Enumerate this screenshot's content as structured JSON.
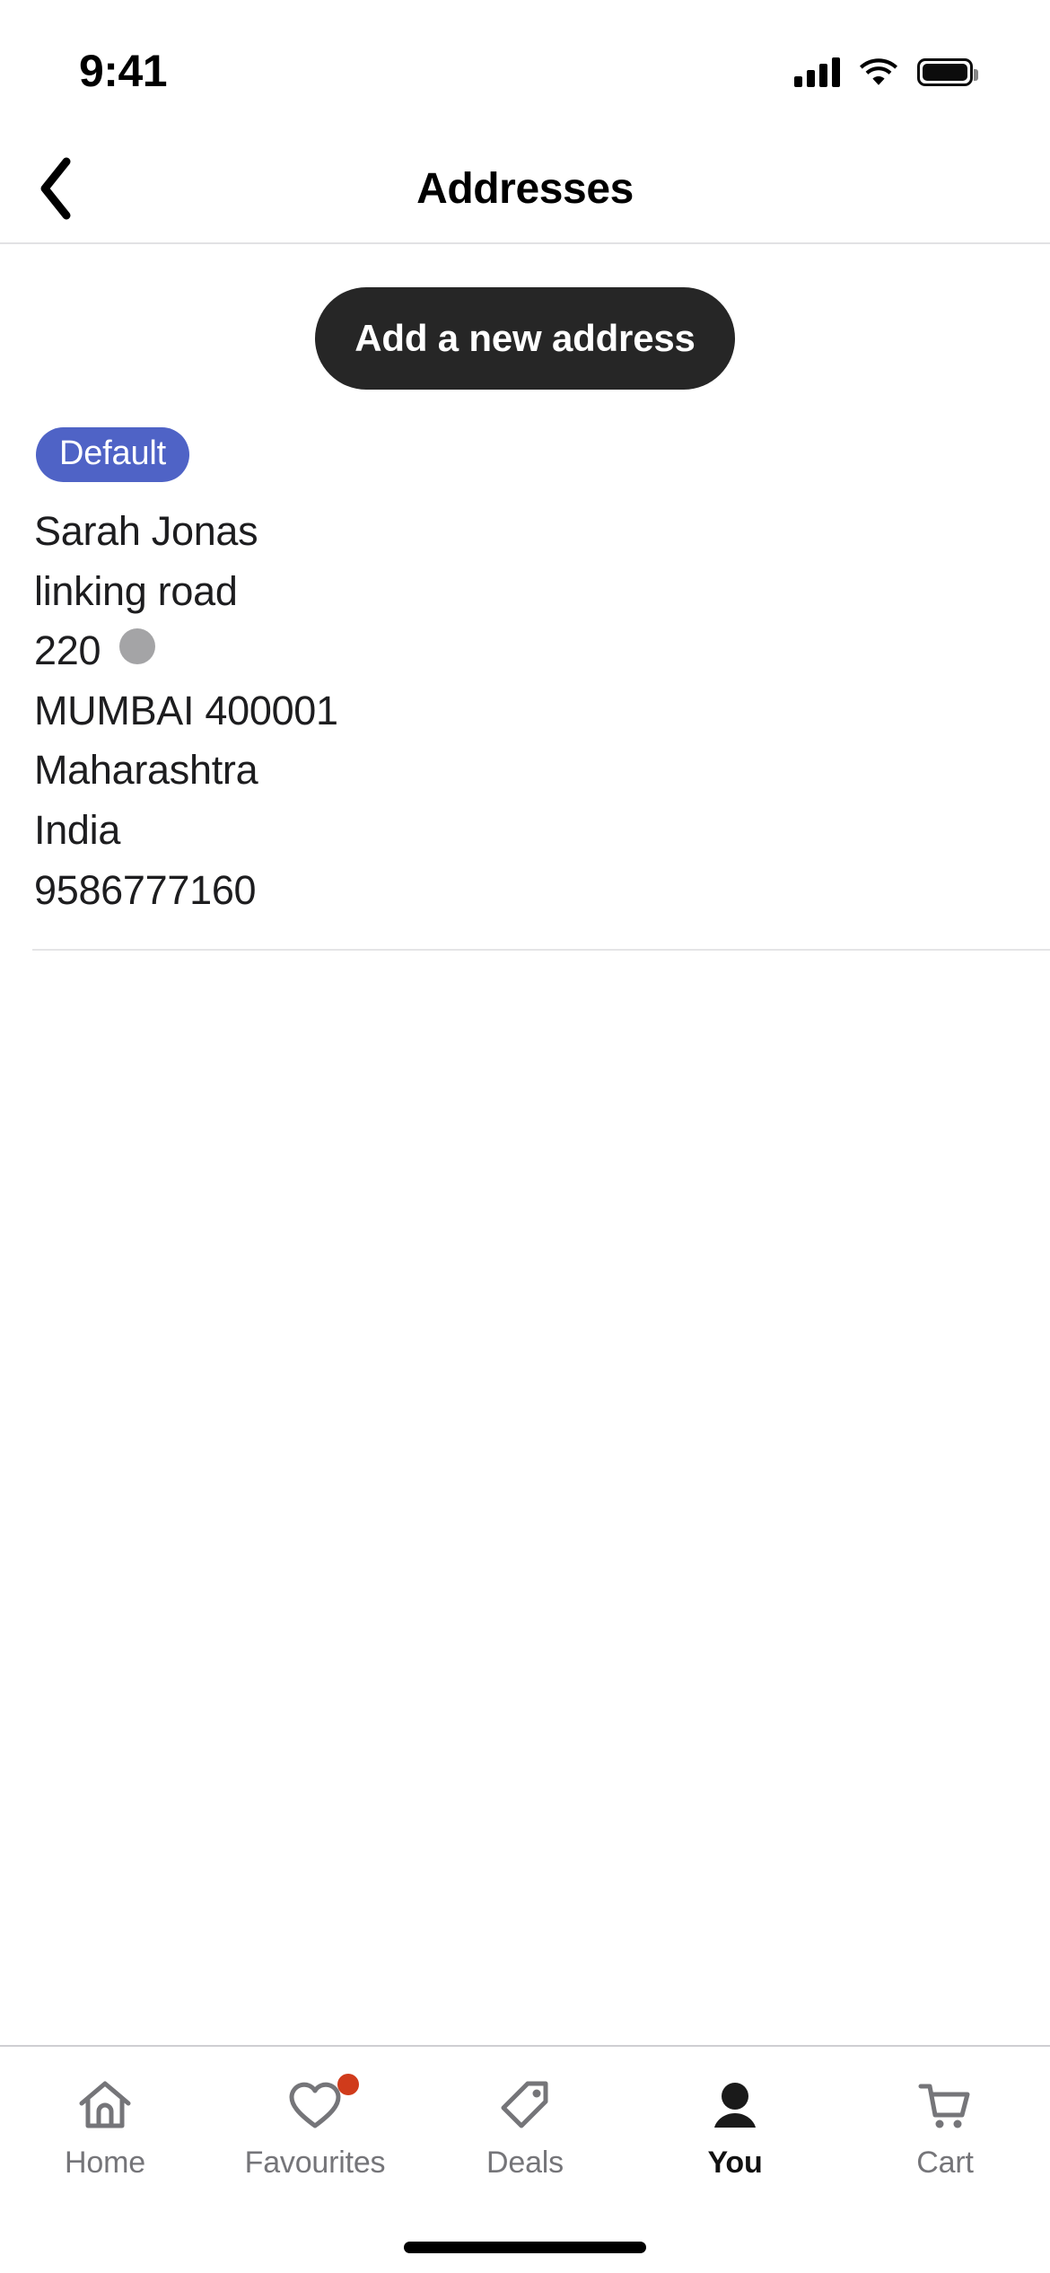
{
  "status_bar": {
    "time": "9:41",
    "signal_icon": "cellular-signal-icon",
    "wifi_icon": "wifi-icon",
    "battery_icon": "battery-full-icon"
  },
  "header": {
    "back_icon": "chevron-left-icon",
    "title": "Addresses"
  },
  "main": {
    "add_address_button": "Add a new address",
    "address_card": {
      "badge": "Default",
      "lines": [
        "Sarah Jonas",
        "linking road",
        "220",
        "MUMBAI 400001",
        "Maharashtra",
        "India",
        "9586777160"
      ],
      "name": "Sarah Jonas",
      "street": "linking road",
      "house_number": "220",
      "city_postcode": "MUMBAI 400001",
      "state": "Maharashtra",
      "country": "India",
      "phone": "9586777160"
    }
  },
  "tab_bar": {
    "tabs": [
      {
        "label": "Home",
        "icon": "home-icon",
        "active": false,
        "badge": false
      },
      {
        "label": "Favourites",
        "icon": "heart-icon",
        "active": false,
        "badge": true
      },
      {
        "label": "Deals",
        "icon": "tag-icon",
        "active": false,
        "badge": false
      },
      {
        "label": "You",
        "icon": "person-icon",
        "active": true,
        "badge": false
      },
      {
        "label": "Cart",
        "icon": "shopping-cart-icon",
        "active": false,
        "badge": false
      }
    ]
  },
  "colors": {
    "accent_badge": "#4f63c6",
    "button_dark": "#262626",
    "notification_dot": "#d03b1b",
    "inactive_tab": "#757579",
    "text_primary": "#1d1d1f"
  }
}
